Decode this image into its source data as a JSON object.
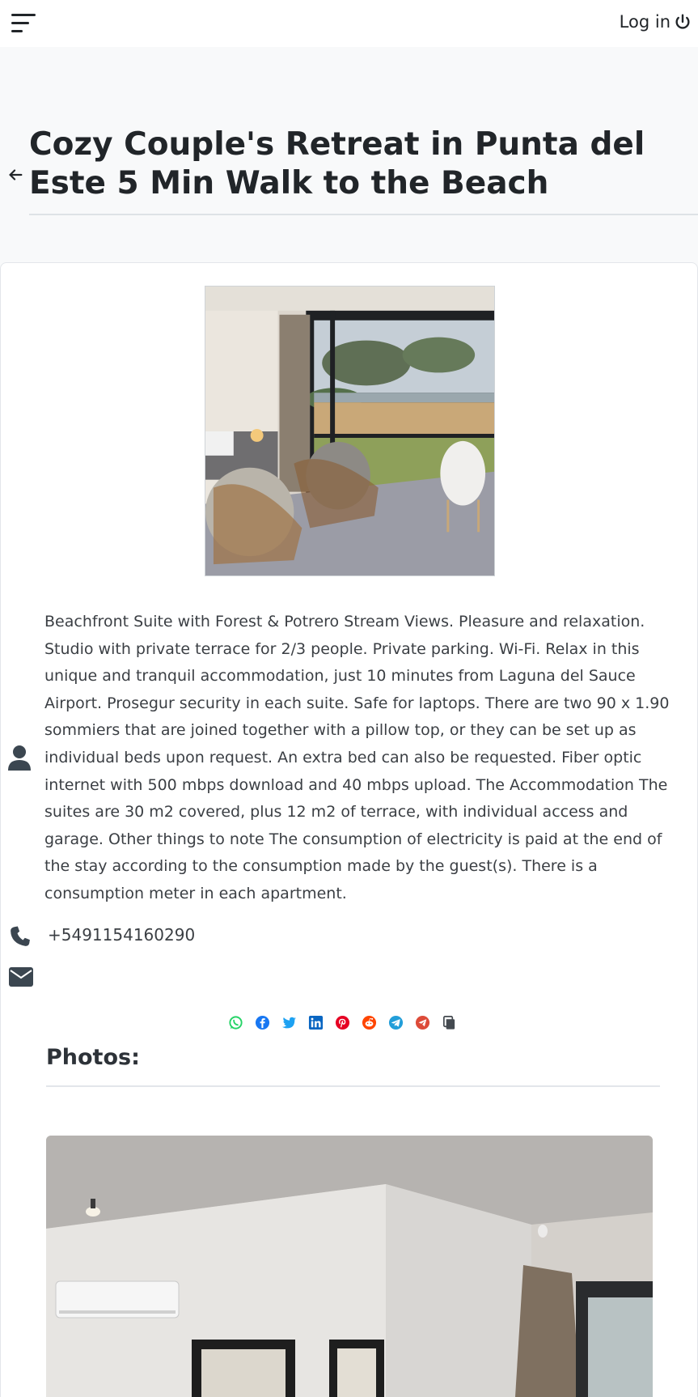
{
  "topbar": {
    "menu_icon": "hamburger-menu-icon",
    "login_label": "Log in",
    "login_icon": "power-icon"
  },
  "header": {
    "back_icon": "arrow-left-icon",
    "title": "Cozy Couple's Retreat in Punta del Este 5 Min Walk to the Beach"
  },
  "listing": {
    "description": "Beachfront Suite with Forest & Potrero Stream Views. Pleasure and relaxation. Studio with private terrace for 2/3 people. Private parking. Wi-Fi. Relax in this unique and tranquil accommodation, just 10 minutes from Laguna del Sauce Airport. Prosegur security in each suite. Safe for laptops. There are two 90 x 1.90 sommiers that are joined together with a pillow top, or they can be set up as individual beds upon request. An extra bed can also be requested. Fiber optic internet with 500 mbps download and 40 mbps upload. The Accommodation The suites are 30 m2 covered, plus 12 m2 of terrace, with individual access and garage. Other things to note The consumption of electricity is paid at the end of the stay according to the consumption made by the guest(s). There is a consumption meter in each apartment.",
    "phone": "+5491154160290",
    "user_icon": "user-icon",
    "phone_icon": "phone-icon",
    "email_icon": "envelope-icon"
  },
  "share": {
    "icons": [
      "whatsapp-icon",
      "facebook-icon",
      "twitter-icon",
      "linkedin-icon",
      "pinterest-icon",
      "reddit-icon",
      "telegram-icon",
      "email-share-icon",
      "copy-link-icon"
    ],
    "colors": {
      "whatsapp": "#25d366",
      "facebook": "#1877f2",
      "twitter": "#1da1f2",
      "linkedin": "#0a66c2",
      "pinterest": "#e60023",
      "reddit": "#ff4500",
      "telegram": "#229ed9",
      "email": "#dd4b39",
      "copy": "#444a50"
    }
  },
  "photos": {
    "title": "Photos:"
  }
}
